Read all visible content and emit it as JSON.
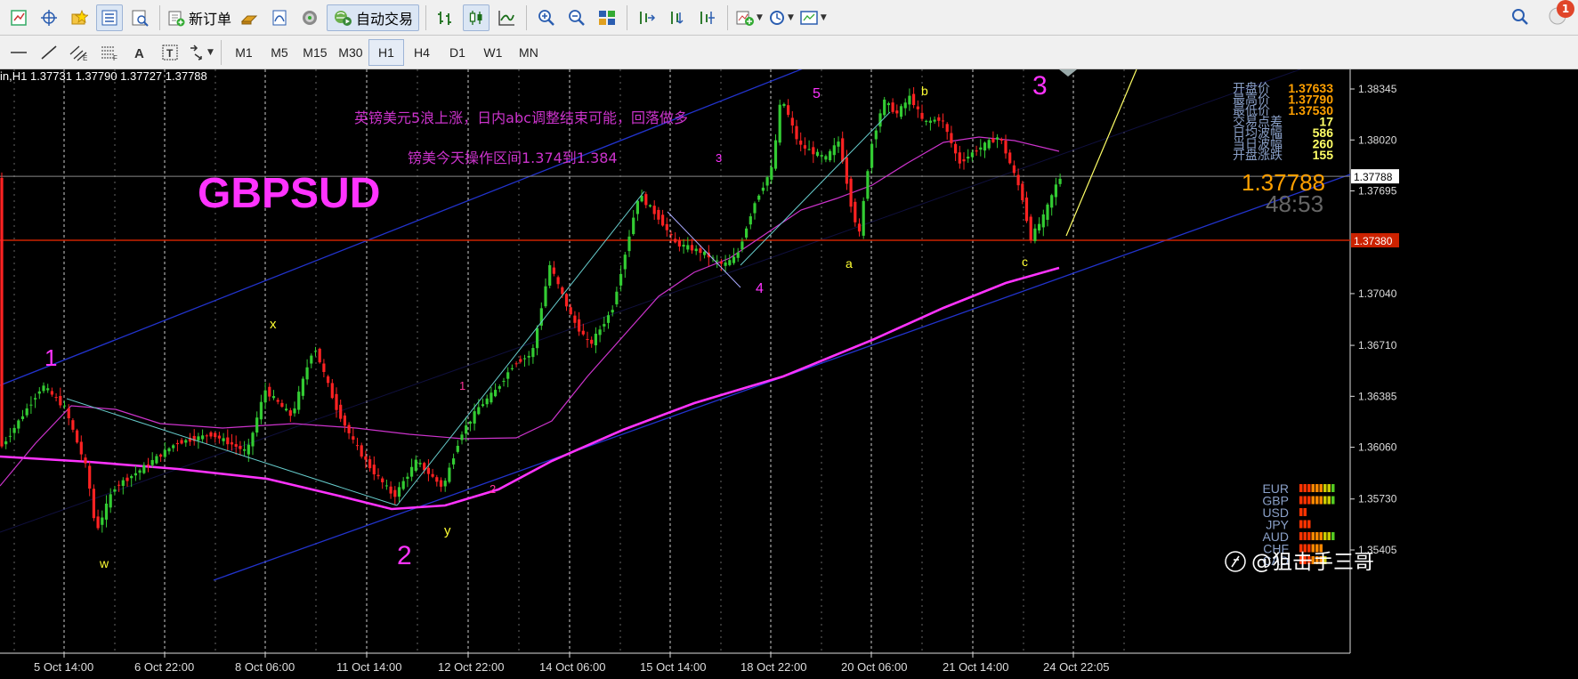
{
  "toolbar1": {
    "new_order_label": "新订单",
    "auto_trade_label": "自动交易",
    "notification_count": "1"
  },
  "toolbar2": {
    "timeframes": [
      "M1",
      "M5",
      "M15",
      "M30",
      "H1",
      "H4",
      "D1",
      "W1",
      "MN"
    ],
    "active_timeframe": "H1"
  },
  "chart": {
    "info_line": "in,H1  1.37731  1.37790  1.37727  1.37788",
    "symbol_title": "GBPSUD",
    "annotation_line1": "英镑美元5浪上涨，日内abc调整结束可能，回落做多",
    "annotation_line2": "镑美今天操作区间1.374到1.384",
    "current_price": "1.37788",
    "timer": "48:53",
    "current_price_tag": "1.37788",
    "horizontal_line_tag": "1.37380",
    "price_axis": [
      "1.38345",
      "1.38020",
      "1.37695",
      "1.37040",
      "1.36710",
      "1.36385",
      "1.36060",
      "1.35730",
      "1.35405"
    ],
    "time_axis": [
      "5 Oct 14:00",
      "6 Oct 22:00",
      "8 Oct 06:00",
      "11 Oct 14:00",
      "12 Oct 22:00",
      "14 Oct 06:00",
      "15 Oct 14:00",
      "18 Oct 22:00",
      "20 Oct 06:00",
      "21 Oct 14:00",
      "24 Oct 22:05"
    ],
    "stats": [
      {
        "label": "开盘价",
        "value": "1.37633",
        "color": "#ffa000"
      },
      {
        "label": "最高价",
        "value": "1.37790",
        "color": "#ffa000"
      },
      {
        "label": "最低价",
        "value": "1.37530",
        "color": "#ffa000"
      },
      {
        "label": "交易点差",
        "value": "17",
        "color": "#ffff66"
      },
      {
        "label": "日均波幅",
        "value": "586",
        "color": "#ffff66"
      },
      {
        "label": "当日波幅",
        "value": "260",
        "color": "#ffff66"
      },
      {
        "label": "开盘涨跌",
        "value": "155",
        "color": "#ffff66"
      }
    ],
    "currency_strength": [
      {
        "ccy": "EUR",
        "level": 0.85
      },
      {
        "ccy": "GBP",
        "level": 0.85
      },
      {
        "ccy": "USD",
        "level": 0.15
      },
      {
        "ccy": "JPY",
        "level": 0.3
      },
      {
        "ccy": "AUD",
        "level": 0.85
      },
      {
        "ccy": "CHF",
        "level": 0.55
      },
      {
        "ccy": "CAD",
        "level": 0.7
      }
    ],
    "wave_labels": [
      {
        "text": "1",
        "color": "#ff33ff"
      },
      {
        "text": "2",
        "color": "#ff33ff"
      },
      {
        "text": "3",
        "color": "#ff33ff"
      },
      {
        "text": "x",
        "color": "#ffff33"
      },
      {
        "text": "w",
        "color": "#ffff33"
      },
      {
        "text": "y",
        "color": "#ffff33"
      },
      {
        "text": "1",
        "color": "#ff3399"
      },
      {
        "text": "2",
        "color": "#ff3399"
      },
      {
        "text": "3",
        "color": "#ff33ff"
      },
      {
        "text": "4",
        "color": "#ff33ff"
      },
      {
        "text": "5",
        "color": "#ff33ff"
      },
      {
        "text": "a",
        "color": "#ffff33"
      },
      {
        "text": "b",
        "color": "#ffff33"
      },
      {
        "text": "c",
        "color": "#ffff33"
      }
    ],
    "watermark": "@狙击手三哥",
    "colors": {
      "background": "#000000",
      "bull_candle": "#33cc33",
      "bear_candle": "#ff2222",
      "ma_long": "#ff33ff",
      "ma_short": "#cc33cc",
      "channel": "#2233cc",
      "symbol_title": "#ff33ff",
      "horizontal_line": "#cc2200"
    }
  }
}
